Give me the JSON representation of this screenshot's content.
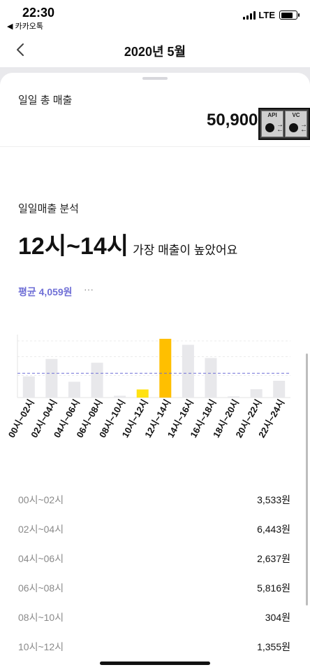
{
  "status_bar": {
    "time": "22:30",
    "back_app": "◀ 카카오톡",
    "network": "LTE"
  },
  "nav": {
    "title": "2020년 5월"
  },
  "summary": {
    "label": "일일 총 매출",
    "value": "50,900"
  },
  "overlay": {
    "left_label": "API",
    "right_label": "VC"
  },
  "analysis": {
    "label": "일일매출 분석",
    "peak_range": "12시~14시",
    "peak_desc": "가장 매출이 높았어요",
    "average": "평균 4,059원",
    "more": "···"
  },
  "colors": {
    "accent": "#6f6fd6",
    "bar_default": "#e8e8eb",
    "bar_peak": "#ffbf00",
    "bar_second": "#ffe212"
  },
  "chart_data": {
    "type": "bar",
    "categories": [
      "00시~02시",
      "02시~04시",
      "04시~06시",
      "06시~08시",
      "08시~10시",
      "10시~12시",
      "12시~14시",
      "14시~16시",
      "16시~18시",
      "18시~20시",
      "20시~22시",
      "22시~24시"
    ],
    "values": [
      3533,
      6443,
      2637,
      5816,
      304,
      1355,
      9800,
      8800,
      6600,
      200,
      1400,
      2800
    ],
    "average": 4059,
    "highlight": {
      "peak": 6,
      "second": 5
    },
    "ylim": [
      0,
      10500
    ]
  },
  "list": [
    {
      "label": "00시~02시",
      "amount": "3,533원"
    },
    {
      "label": "02시~04시",
      "amount": "6,443원"
    },
    {
      "label": "04시~06시",
      "amount": "2,637원"
    },
    {
      "label": "06시~08시",
      "amount": "5,816원"
    },
    {
      "label": "08시~10시",
      "amount": "304원"
    },
    {
      "label": "10시~12시",
      "amount": "1,355원"
    }
  ]
}
